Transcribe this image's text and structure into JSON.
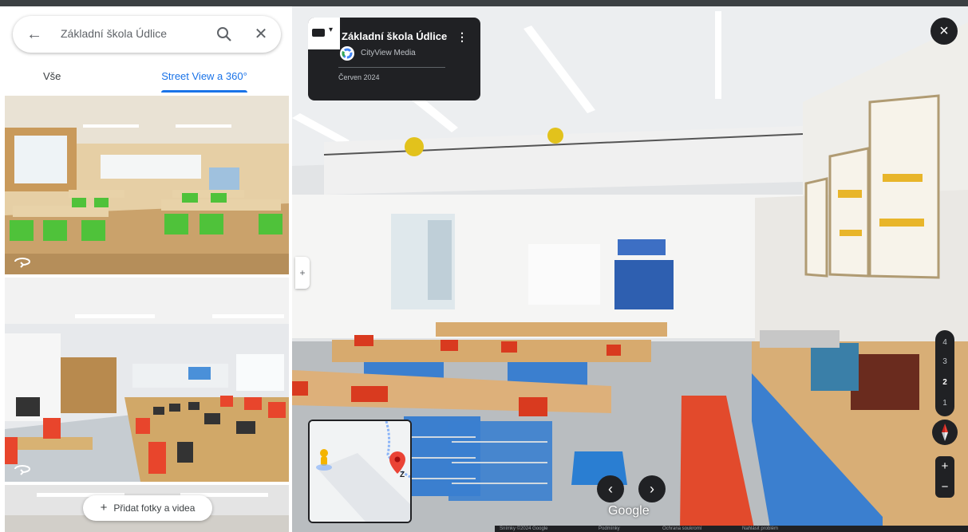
{
  "search": {
    "query": "Základní škola Údlice"
  },
  "icons": {
    "back": "arrow-left-icon",
    "search": "search-icon",
    "close": "close-icon",
    "rotate": "360-rotate-icon",
    "plus": "plus-icon",
    "menu": "more-vert-icon",
    "keyboard": "keyboard-icon",
    "caret": "chevron-down-icon",
    "expand": "chevron-right-icon",
    "compass": "compass-icon",
    "nav_prev": "chevron-left-icon",
    "nav_next": "chevron-right-icon",
    "pegman": "pegman-icon",
    "pin": "map-pin-icon"
  },
  "tabs": [
    {
      "label": "Vše",
      "active": false
    },
    {
      "label": "Street View a 360°",
      "active": true
    }
  ],
  "add_photos": {
    "label": "Přidat fotky a videa"
  },
  "infocard": {
    "title": "Základní škola Údlice",
    "author": "CityView Media",
    "date": "Červen 2024"
  },
  "buttons": {
    "close": "×",
    "side_toggle": "+"
  },
  "nav": {
    "prev": "‹",
    "next": "›"
  },
  "brand": {
    "label": "Google"
  },
  "floors": [
    "4",
    "3",
    "2",
    "1"
  ],
  "floor_selected": "2",
  "zoom": {
    "in": "+",
    "out": "−"
  },
  "minimap": {
    "pin_letter": "Z"
  },
  "footer": {
    "items": [
      "Snímky ©2024 Google",
      "Podmínky",
      "Ochrana soukromí",
      "Nahlásit problém"
    ]
  },
  "colors": {
    "accent": "#1a73e8",
    "dark": "#202124",
    "pin": "#ea4335"
  }
}
